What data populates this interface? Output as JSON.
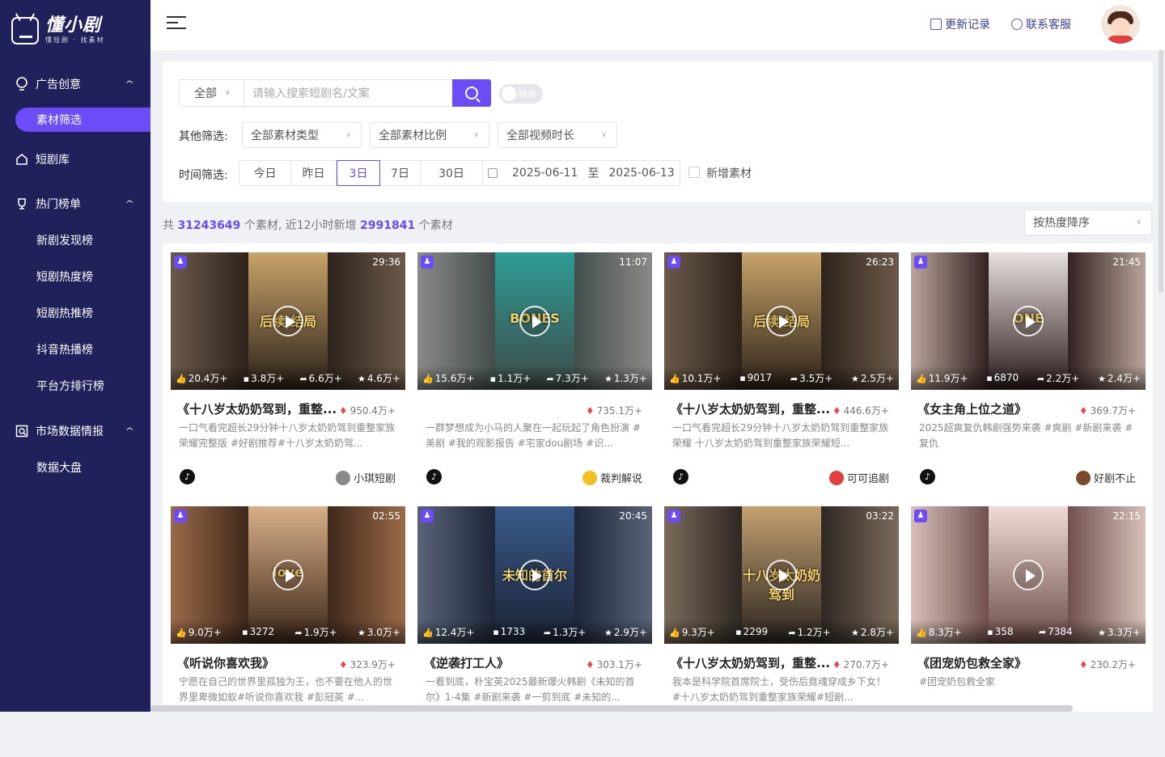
{
  "brand": {
    "name": "懂小剧",
    "tagline": "懂短剧 · 找素材"
  },
  "sidebar": {
    "groups": [
      {
        "label": "广告创意",
        "items": [
          "素材筛选"
        ]
      },
      {
        "label": "短剧库"
      },
      {
        "label": "热门榜单",
        "items": [
          "新剧发现榜",
          "短剧热度榜",
          "短剧热推榜",
          "抖音热播榜",
          "平台方排行榜"
        ]
      },
      {
        "label": "市场数据情报",
        "items": [
          "数据大盘"
        ]
      }
    ],
    "active": "素材筛选"
  },
  "topbar": {
    "update_log": "更新记录",
    "contact": "联系客服"
  },
  "search": {
    "category": "全部",
    "placeholder": "请输入搜索短剧名/文案",
    "toggle_label": "精准"
  },
  "filters": {
    "other_label": "其他筛选:",
    "material_type": "全部素材类型",
    "material_ratio": "全部素材比例",
    "video_duration": "全部视频时长",
    "time_label": "时间筛选:",
    "time_options": [
      "今日",
      "昨日",
      "3日",
      "7日",
      "30日"
    ],
    "time_selected": "3日",
    "start_date": "2025-06-11",
    "to": "至",
    "end_date": "2025-06-13",
    "new_material": "新增素材"
  },
  "stats": {
    "prefix": "共",
    "total": "31243649",
    "mid": "个素材, 近12小时新增",
    "new": "2991841",
    "suffix": "个素材"
  },
  "sort": {
    "label": "按热度降序"
  },
  "cards": [
    {
      "duration": "29:36",
      "likes": "20.4万+",
      "comments": "3.8万+",
      "shares": "6.6万+",
      "favorites": "4.6万+",
      "title": "《十八岁太奶奶驾到，重整...",
      "heat": "950.4万+",
      "desc": "一口气看完超长29分钟十八岁太奶奶驾到重整家族荣耀完整版 #好剧推荐#十八岁太奶奶驾...",
      "author": "小琪短剧",
      "poster_title": "后续·结局"
    },
    {
      "duration": "11:07",
      "likes": "15.6万+",
      "comments": "1.1万+",
      "shares": "7.3万+",
      "favorites": "1.3万+",
      "title": "",
      "heat": "735.1万+",
      "desc": "一群梦想成为小马的人聚在一起玩起了角色扮演 #美剧 #我的观影报告 #宅家dou剧场 #识...",
      "author": "裁判解说",
      "poster_title": "BONES"
    },
    {
      "duration": "26:23",
      "likes": "10.1万+",
      "comments": "9017",
      "shares": "3.5万+",
      "favorites": "2.5万+",
      "title": "《十八岁太奶奶驾到，重整...",
      "heat": "446.6万+",
      "desc": "一口气看完超长29分钟十八岁太奶奶驾到重整家族荣耀 十八岁太奶奶驾到重整家族荣耀短...",
      "author": "可可追剧",
      "poster_title": "后续·结局"
    },
    {
      "duration": "21:45",
      "likes": "11.9万+",
      "comments": "6870",
      "shares": "2.2万+",
      "favorites": "2.4万+",
      "title": "《女主角上位之道》",
      "heat": "369.7万+",
      "desc": "2025超爽复仇韩剧强势来袭 #爽剧 #新剧来袭 #复仇",
      "author": "好剧不止",
      "poster_title": "ONE"
    },
    {
      "duration": "02:55",
      "likes": "9.0万+",
      "comments": "3272",
      "shares": "1.9万+",
      "favorites": "3.0万+",
      "title": "《听说你喜欢我》",
      "heat": "323.9万+",
      "desc": "宁愿在自己的世界里孤独为王，也不要在他人的世界里卑微如蚁#听说你喜欢我 #彭冠英 #...",
      "author": "",
      "poster_title": "love"
    },
    {
      "duration": "20:45",
      "likes": "12.4万+",
      "comments": "1733",
      "shares": "1.3万+",
      "favorites": "2.9万+",
      "title": "《逆袭打工人》",
      "heat": "303.1万+",
      "desc": "一看到底，朴宝英2025最新爆火韩剧《未知的首尔》1-4集 #新剧来袭 #一剪到底 #未知的...",
      "author": "",
      "poster_title": "未知的首尔"
    },
    {
      "duration": "03:22",
      "likes": "9.3万+",
      "comments": "2299",
      "shares": "1.2万+",
      "favorites": "2.8万+",
      "title": "《十八岁太奶奶驾到，重整...",
      "heat": "270.7万+",
      "desc": "我本是科学院首席院士，受伤后竟魂穿成乡下女！ #十八岁太奶奶驾到重整家族荣耀#短剧...",
      "author": "",
      "poster_title": "十八岁太奶奶驾到"
    },
    {
      "duration": "22:15",
      "likes": "8.3万+",
      "comments": "358",
      "shares": "7384",
      "favorites": "3.3万+",
      "title": "《团宠奶包救全家》",
      "heat": "230.2万+",
      "desc": "#团宠奶包救全家",
      "author": "",
      "poster_title": ""
    }
  ],
  "colors": {
    "sidebar": "#20205a",
    "accent": "#6b4cf6"
  }
}
